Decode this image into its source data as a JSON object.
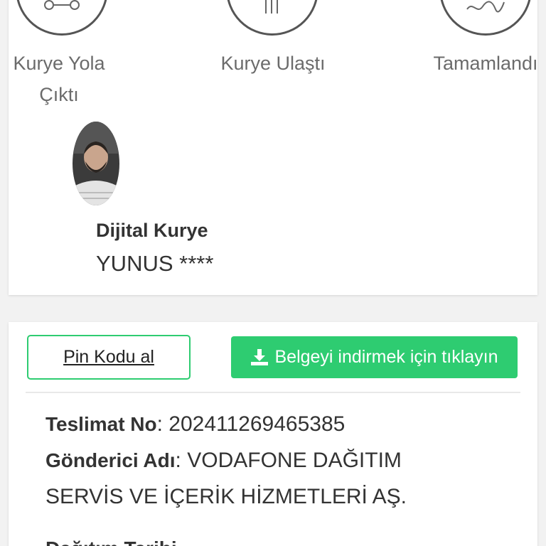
{
  "steps": [
    {
      "icon": "scooter-icon",
      "label": "Kurye Yola Çıktı"
    },
    {
      "icon": "fork-icon",
      "label": "Kurye Ulaştı"
    },
    {
      "icon": "signature-icon",
      "label": "Tamamlandı"
    }
  ],
  "courier": {
    "title": "Dijital Kurye",
    "name": "YUNUS ****"
  },
  "actions": {
    "pin_label": "Pin Kodu al",
    "download_label": "Belgeyi indirmek için tıklayın"
  },
  "delivery": {
    "number_label": "Teslimat No",
    "number_value": "202411269465385",
    "sender_label": "Gönderici Adı",
    "sender_value_line1": "VODAFONE DAĞITIM",
    "sender_value_line2": "SERVİS VE İÇERİK HİZMETLERİ AŞ.",
    "next_label_partial": "Dağıtım Tarihi"
  },
  "colors": {
    "accent": "#2ecc71",
    "text": "#333333",
    "muted": "#6b6b6b"
  }
}
